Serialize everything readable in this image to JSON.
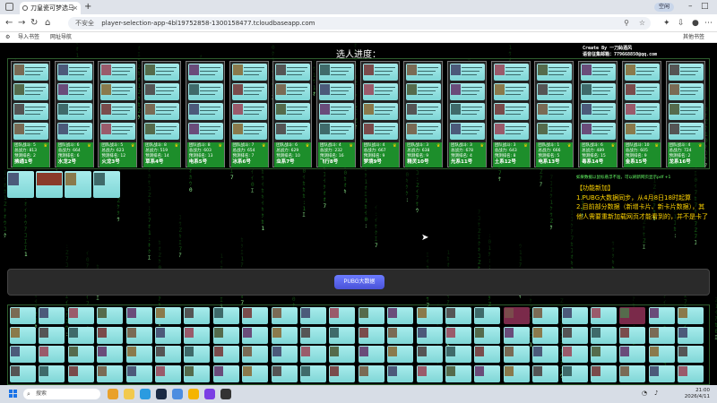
{
  "browser": {
    "tab_title": "刀皇瓷可梦选马",
    "url": "player-selection-app-4bl19752858-1300158477.tcloudbaseapp.com",
    "security_label": "不安全",
    "profile_label": "空闲",
    "bookmarks": [
      "导入书签",
      "网址导航"
    ],
    "bookmarks_right": "其他书签"
  },
  "page": {
    "title": "选人进度：",
    "credit_line1": "Create By 一刀鈊酒风",
    "credit_line2": "语音征集邮箱：779668850@qq.com",
    "button_label": "PUBG大数据"
  },
  "labels": {
    "team_power": "团队战斗:",
    "total_power": "总战力:",
    "predicted_rank": "预测排名:"
  },
  "teams": [
    {
      "power": "5",
      "total": "813",
      "rank": "2",
      "name": "拂通1号",
      "border": "#777"
    },
    {
      "power": "6",
      "total": "664",
      "rank": "6",
      "name": "水龙2号",
      "border": "#777"
    },
    {
      "power": "5",
      "total": "623",
      "rank": "12",
      "name": "火龙3号",
      "border": "#777"
    },
    {
      "power": "8",
      "total": "519",
      "rank": "14",
      "name": "草系4号",
      "border": "#777"
    },
    {
      "power": "8",
      "total": "603",
      "rank": "13",
      "name": "电系5号",
      "border": "#777"
    },
    {
      "power": "7",
      "total": "654",
      "rank": "7",
      "name": "冰系6号",
      "border": "#777"
    },
    {
      "power": "6",
      "total": "629",
      "rank": "10",
      "name": "虫系7号",
      "border": "#777"
    },
    {
      "power": "4",
      "total": "232",
      "rank": "16",
      "name": "飞行8号",
      "border": "#777"
    },
    {
      "power": "4",
      "total": "667",
      "rank": "9",
      "name": "梦境9号",
      "border": "#777"
    },
    {
      "power": "3",
      "total": "638",
      "rank": "9",
      "name": "精灵10号",
      "border": "#777"
    },
    {
      "power": "3",
      "total": "678",
      "rank": "4",
      "name": "光系11号",
      "border": "#777"
    },
    {
      "power": "3",
      "total": "643",
      "rank": "8",
      "name": "土系12号",
      "border": "#777"
    },
    {
      "power": "1",
      "total": "666",
      "rank": "5",
      "name": "电系13号",
      "border": "#777"
    },
    {
      "power": "6",
      "total": "489",
      "rank": "15",
      "name": "毒系14号",
      "border": "#777"
    },
    {
      "power": "10",
      "total": "605",
      "rank": "9",
      "name": "金系15号",
      "border": "#777"
    },
    {
      "power": "4",
      "total": "724",
      "rank": "2",
      "name": "龙系16号",
      "border": "#777"
    }
  ],
  "notice": {
    "small_text": "如果数据以鼠标悬浮不准，可以刷新网页显示pdf +1",
    "line1": "【功能新加】",
    "line2": "1.PUBG大数据同步，从4月8日18时起算",
    "line3": "2.目前部分数据（新增卡片、新卡片数据），其他人需要重新加载网页才能看到的，并不是卡了"
  },
  "taskbar": {
    "search_label": "搜索",
    "time": "21:00",
    "date": "2026/4/11"
  }
}
